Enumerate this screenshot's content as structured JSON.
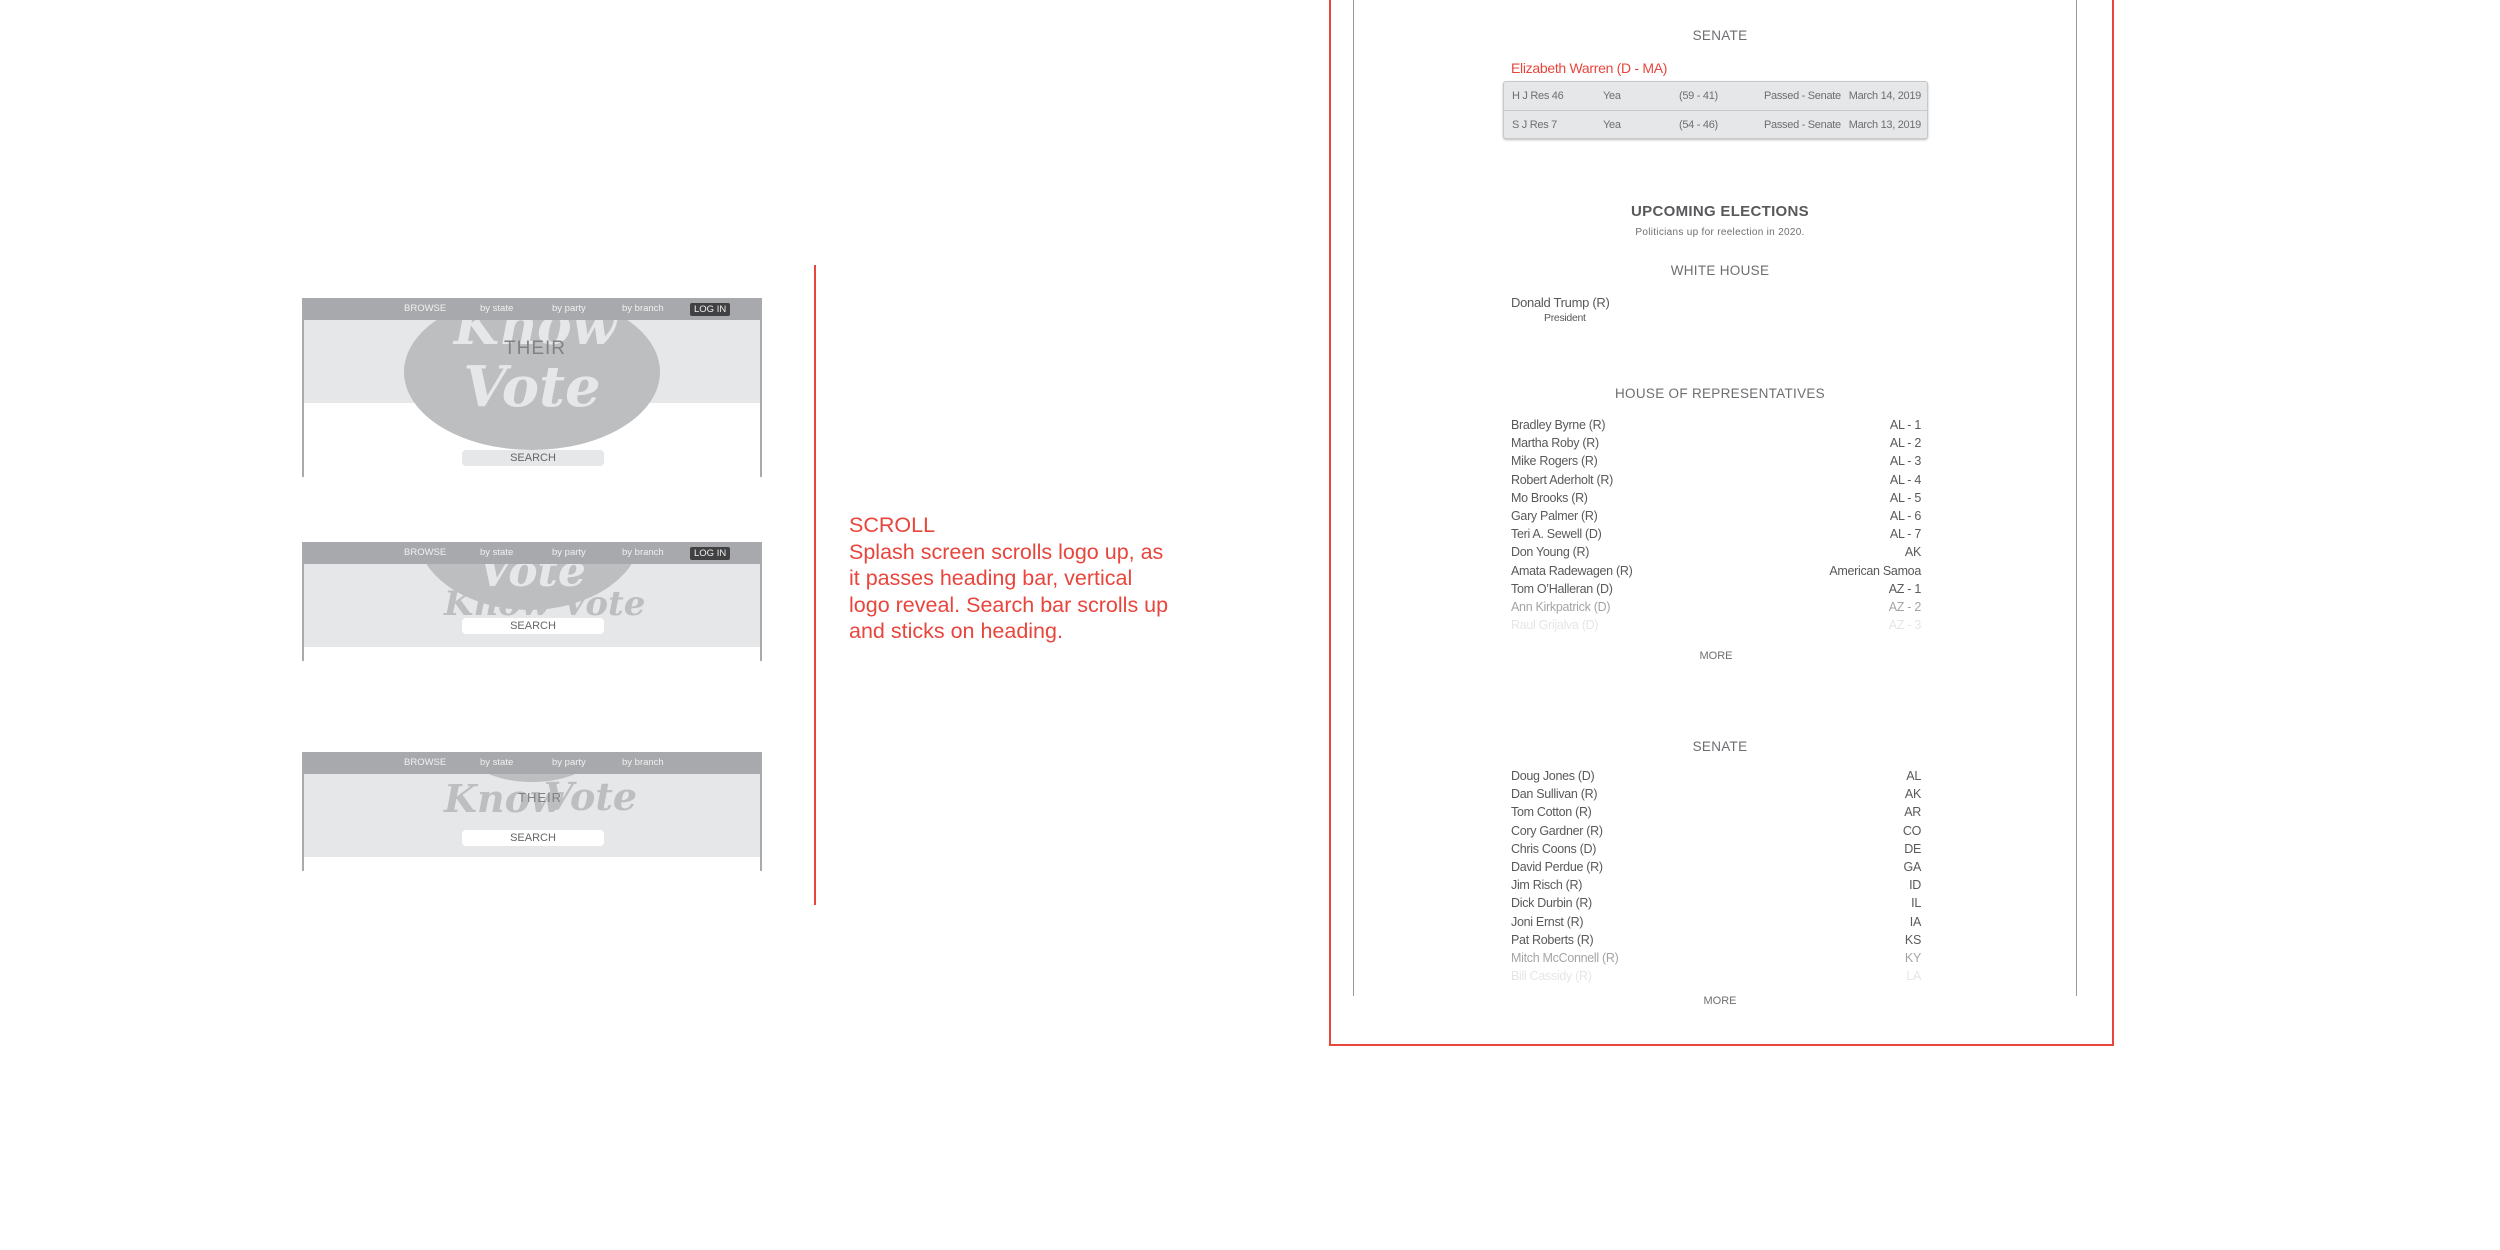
{
  "nav": {
    "browse": "BROWSE",
    "by_state": "by state",
    "by_party": "by party",
    "by_branch": "by branch",
    "login": "LOG IN"
  },
  "logo": {
    "know": "Know",
    "their": "THEIR",
    "vote": "Vote"
  },
  "search_label": "SEARCH",
  "note": {
    "title": "SCROLL",
    "body": "Splash screen scrolls logo up, as it passes heading bar, vertical logo reveal. Search bar scrolls up and sticks on heading."
  },
  "colors": {
    "accent": "#e8453c",
    "nav": "#a7a9ac",
    "band": "#e6e7e8"
  },
  "votes": {
    "heading": "SENATE",
    "senator": "Elizabeth Warren (D - MA)",
    "rows": [
      {
        "bill": "H J Res 46",
        "vote": "Yea",
        "tally": "(59 - 41)",
        "status": "Passed - Senate",
        "date": "March 14, 2019"
      },
      {
        "bill": "S J Res 7",
        "vote": "Yea",
        "tally": "(54 - 46)",
        "status": "Passed - Senate",
        "date": "March 13, 2019"
      }
    ]
  },
  "upcoming": {
    "title": "UPCOMING ELECTIONS",
    "subtitle": "Politicians up for reelection in 2020.",
    "white_house": {
      "heading": "WHITE HOUSE",
      "name": "Donald Trump (R)",
      "role": "President"
    },
    "house": {
      "heading": "HOUSE OF REPRESENTATIVES",
      "rows": [
        {
          "name": "Bradley Byrne (R)",
          "district": "AL - 1"
        },
        {
          "name": "Martha Roby (R)",
          "district": "AL - 2"
        },
        {
          "name": "Mike Rogers (R)",
          "district": "AL - 3"
        },
        {
          "name": "Robert Aderholt (R)",
          "district": "AL - 4"
        },
        {
          "name": "Mo Brooks (R)",
          "district": "AL - 5"
        },
        {
          "name": "Gary Palmer (R)",
          "district": "AL - 6"
        },
        {
          "name": "Teri A. Sewell (D)",
          "district": "AL - 7"
        },
        {
          "name": "Don Young (R)",
          "district": "AK"
        },
        {
          "name": "Amata Radewagen (R)",
          "district": "American Samoa"
        },
        {
          "name": "Tom O’Halleran (D)",
          "district": "AZ - 1"
        },
        {
          "name": "Ann Kirkpatrick (D)",
          "district": "AZ - 2"
        },
        {
          "name": "Raul Grijalva (D)",
          "district": "AZ - 3"
        }
      ],
      "more": "MORE"
    },
    "senate": {
      "heading": "SENATE",
      "rows": [
        {
          "name": "Doug Jones (D)",
          "district": "AL"
        },
        {
          "name": "Dan Sullivan (R)",
          "district": "AK"
        },
        {
          "name": "Tom Cotton (R)",
          "district": "AR"
        },
        {
          "name": "Cory Gardner (R)",
          "district": "CO"
        },
        {
          "name": "Chris Coons (D)",
          "district": "DE"
        },
        {
          "name": "David Perdue (R)",
          "district": "GA"
        },
        {
          "name": "Jim Risch (R)",
          "district": "ID"
        },
        {
          "name": "Dick Durbin (R)",
          "district": "IL"
        },
        {
          "name": "Joni Ernst (R)",
          "district": "IA"
        },
        {
          "name": "Pat Roberts (R)",
          "district": "KS"
        },
        {
          "name": "Mitch McConnell (R)",
          "district": "KY"
        },
        {
          "name": "Bill Cassidy (R)",
          "district": "LA"
        }
      ],
      "more": "MORE"
    }
  }
}
